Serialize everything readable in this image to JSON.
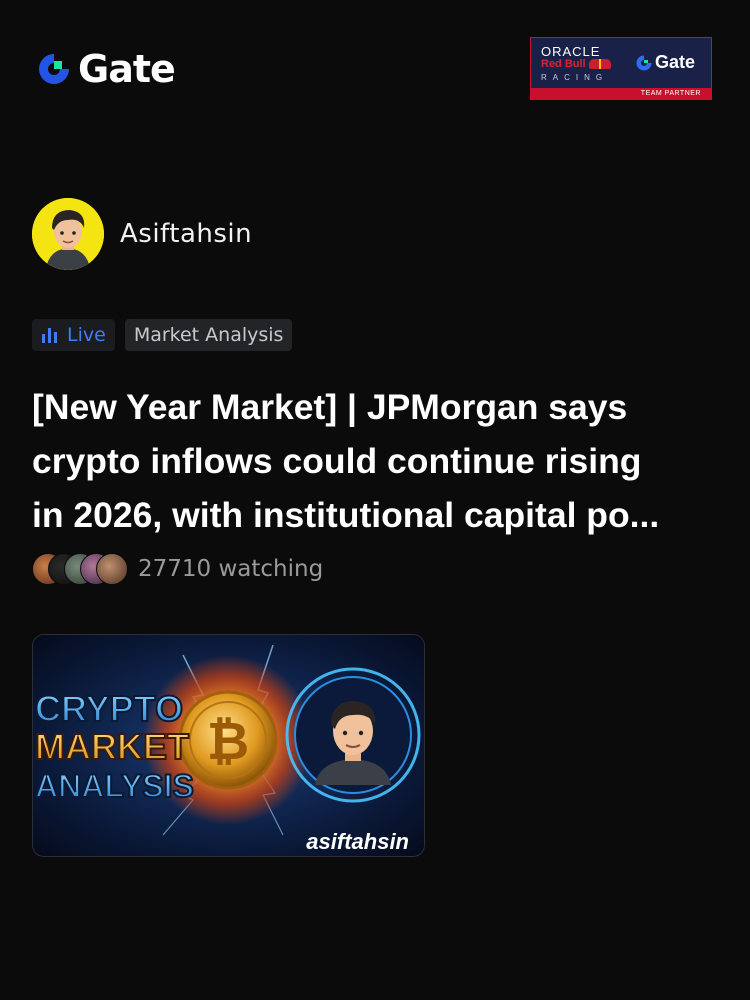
{
  "brand": {
    "name": "Gate"
  },
  "partner": {
    "line1": "ORACLE",
    "line2": "Red Bull",
    "line3": "RACING",
    "gate": "Gate",
    "footer": "TEAM PARTNER"
  },
  "author": {
    "name": "Asiftahsin"
  },
  "tags": {
    "live": "Live",
    "category": "Market Analysis"
  },
  "headline": {
    "lines": [
      "[New Year Market] | JPMorgan says",
      "crypto inflows could continue rising",
      "in 2026, with institutional capital po..."
    ]
  },
  "watching": {
    "count_text": "27710 watching"
  },
  "thumbnail": {
    "title_lines": [
      "CRYPTO",
      "MARKET",
      "ANALYSIS"
    ],
    "coin_symbol": "₿",
    "handle": "asiftahsin"
  },
  "colors": {
    "background": "#0b0b0c",
    "accent_blue": "#3f7cf5",
    "gate_green": "#17e5a0",
    "gate_blue": "#2354e6"
  }
}
